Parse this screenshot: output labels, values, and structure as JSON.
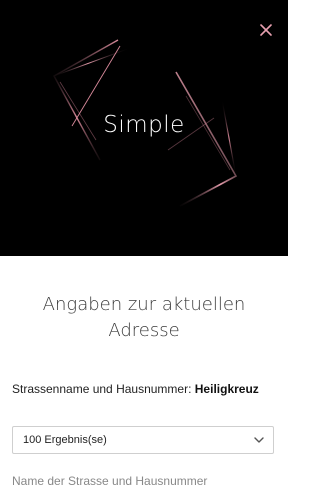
{
  "hero": {
    "brand_text": "Simple",
    "close_icon": "close-icon",
    "colors": {
      "background": "#000000",
      "accent": "#d98a9b",
      "close": "#e8a0b0"
    }
  },
  "form": {
    "heading": "Angaben zur aktuellen Adresse",
    "street_label": "Strassenname und Hausnummer:",
    "street_value": "Heiligkreuz",
    "results_select": {
      "value": "100 Ergebnis(se)",
      "icon": "chevron-down-icon"
    },
    "next_label_partial": "Name der Strasse und Hausnummer"
  }
}
